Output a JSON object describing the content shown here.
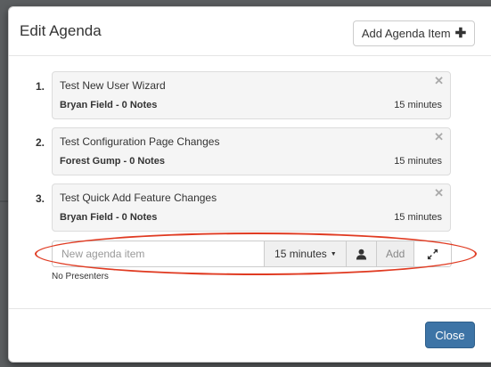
{
  "modal": {
    "title": "Edit Agenda",
    "add_button_label": "Add Agenda Item",
    "add_button_icon": "plus-icon"
  },
  "agenda_items": [
    {
      "number": "1.",
      "title": "Test New User Wizard",
      "presenter": "Bryan Field - 0 Notes",
      "duration": "15 minutes"
    },
    {
      "number": "2.",
      "title": "Test Configuration Page Changes",
      "presenter": "Forest Gump - 0 Notes",
      "duration": "15 minutes"
    },
    {
      "number": "3.",
      "title": "Test Quick Add Feature Changes",
      "presenter": "Bryan Field - 0 Notes",
      "duration": "15 minutes"
    }
  ],
  "new_item": {
    "placeholder": "New agenda item",
    "value": "",
    "duration_label": "15 minutes",
    "presenter_icon": "user-icon",
    "add_label": "Add",
    "expand_icon": "expand-icon",
    "presenters_text": "No Presenters"
  },
  "footer": {
    "close_label": "Close"
  },
  "colors": {
    "primary_button": "#3d74a6",
    "annotation": "#e03b22",
    "backdrop": "#5b5e60"
  }
}
